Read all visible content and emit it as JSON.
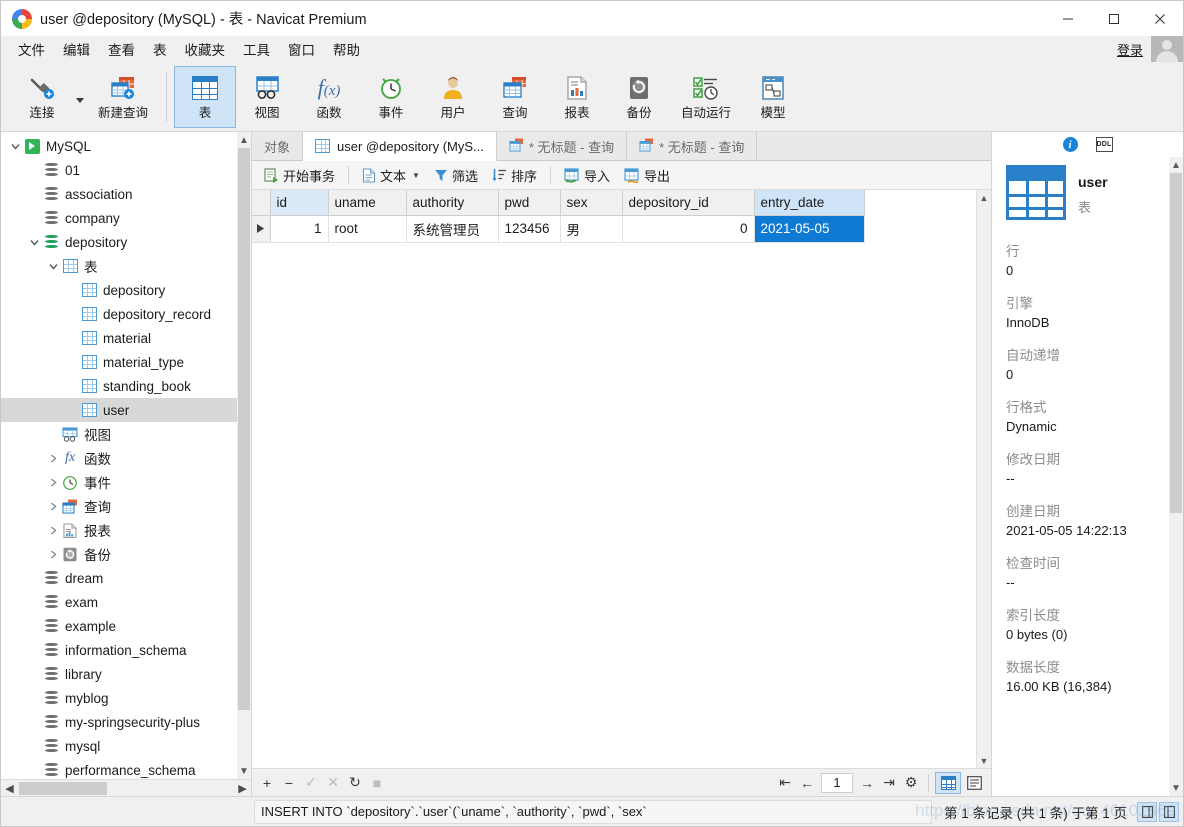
{
  "window": {
    "title": "user @depository (MySQL) - 表 - Navicat Premium",
    "minimize": "—",
    "maximize": "□",
    "close": "✕"
  },
  "menubar": {
    "items": [
      "文件",
      "编辑",
      "查看",
      "表",
      "收藏夹",
      "工具",
      "窗口",
      "帮助"
    ],
    "login_label": "登录"
  },
  "toolbar": {
    "items": [
      {
        "label": "连接",
        "icon": "connection-icon"
      },
      {
        "label": "新建查询",
        "icon": "new-query-icon"
      },
      {
        "label": "表",
        "icon": "table-icon",
        "active": true
      },
      {
        "label": "视图",
        "icon": "view-icon"
      },
      {
        "label": "函数",
        "icon": "function-icon"
      },
      {
        "label": "事件",
        "icon": "event-icon"
      },
      {
        "label": "用户",
        "icon": "user-icon"
      },
      {
        "label": "查询",
        "icon": "query-icon"
      },
      {
        "label": "报表",
        "icon": "report-icon"
      },
      {
        "label": "备份",
        "icon": "backup-icon"
      },
      {
        "label": "自动运行",
        "icon": "automation-icon"
      },
      {
        "label": "模型",
        "icon": "model-icon"
      }
    ]
  },
  "sidebar": {
    "nodes": [
      {
        "label": "MySQL",
        "depth": 0,
        "icon": "mysql-connection-icon",
        "chevron": "down"
      },
      {
        "label": "01",
        "depth": 1,
        "icon": "database-icon",
        "chevron": ""
      },
      {
        "label": "association",
        "depth": 1,
        "icon": "database-icon",
        "chevron": ""
      },
      {
        "label": "company",
        "depth": 1,
        "icon": "database-icon",
        "chevron": ""
      },
      {
        "label": "depository",
        "depth": 1,
        "icon": "database-open-icon",
        "chevron": "down"
      },
      {
        "label": "表",
        "depth": 2,
        "icon": "table-folder-icon",
        "chevron": "down"
      },
      {
        "label": "depository",
        "depth": 3,
        "icon": "table-icon",
        "chevron": ""
      },
      {
        "label": "depository_record",
        "depth": 3,
        "icon": "table-icon",
        "chevron": ""
      },
      {
        "label": "material",
        "depth": 3,
        "icon": "table-icon",
        "chevron": ""
      },
      {
        "label": "material_type",
        "depth": 3,
        "icon": "table-icon",
        "chevron": ""
      },
      {
        "label": "standing_book",
        "depth": 3,
        "icon": "table-icon",
        "chevron": ""
      },
      {
        "label": "user",
        "depth": 3,
        "icon": "table-icon",
        "chevron": "",
        "selected": true
      },
      {
        "label": "视图",
        "depth": 2,
        "icon": "view-folder-icon",
        "chevron": ""
      },
      {
        "label": "函数",
        "depth": 2,
        "icon": "function-folder-icon",
        "chevron": "right"
      },
      {
        "label": "事件",
        "depth": 2,
        "icon": "event-folder-icon",
        "chevron": "right"
      },
      {
        "label": "查询",
        "depth": 2,
        "icon": "query-folder-icon",
        "chevron": "right"
      },
      {
        "label": "报表",
        "depth": 2,
        "icon": "report-folder-icon",
        "chevron": "right"
      },
      {
        "label": "备份",
        "depth": 2,
        "icon": "backup-folder-icon",
        "chevron": "right"
      },
      {
        "label": "dream",
        "depth": 1,
        "icon": "database-icon",
        "chevron": ""
      },
      {
        "label": "exam",
        "depth": 1,
        "icon": "database-icon",
        "chevron": ""
      },
      {
        "label": "example",
        "depth": 1,
        "icon": "database-icon",
        "chevron": ""
      },
      {
        "label": "information_schema",
        "depth": 1,
        "icon": "database-icon",
        "chevron": ""
      },
      {
        "label": "library",
        "depth": 1,
        "icon": "database-icon",
        "chevron": ""
      },
      {
        "label": "myblog",
        "depth": 1,
        "icon": "database-icon",
        "chevron": ""
      },
      {
        "label": "my-springsecurity-plus",
        "depth": 1,
        "icon": "database-icon",
        "chevron": ""
      },
      {
        "label": "mysql",
        "depth": 1,
        "icon": "database-icon",
        "chevron": ""
      },
      {
        "label": "performance_schema",
        "depth": 1,
        "icon": "database-icon",
        "chevron": ""
      }
    ]
  },
  "tabs": [
    {
      "label": "对象",
      "icon": "",
      "active": false
    },
    {
      "label": "user @depository (MyS...",
      "icon": "table-icon",
      "active": true
    },
    {
      "label": "* 无标题 - 查询",
      "icon": "query-icon",
      "active": false
    },
    {
      "label": "* 无标题 - 查询",
      "icon": "query-icon",
      "active": false
    }
  ],
  "gridtools": [
    {
      "label": "开始事务",
      "icon": "transaction-icon"
    },
    {
      "label": "文本",
      "icon": "text-icon",
      "caret": true
    },
    {
      "label": "筛选",
      "icon": "filter-icon"
    },
    {
      "label": "排序",
      "icon": "sort-icon"
    },
    {
      "label": "导入",
      "icon": "import-icon"
    },
    {
      "label": "导出",
      "icon": "export-icon"
    }
  ],
  "grid": {
    "columns": [
      "id",
      "uname",
      "authority",
      "pwd",
      "sex",
      "depository_id",
      "entry_date"
    ],
    "rows": [
      {
        "indicator": "▶",
        "cells": [
          "1",
          "root",
          "系统管理员",
          "123456",
          "男",
          "0",
          "2021-05-05"
        ]
      }
    ],
    "selected_column": "entry_date",
    "selected_cell_value": "2021-05-05"
  },
  "gridfooter": {
    "buttons": [
      "+",
      "−",
      "✓",
      "✕",
      "↻",
      "■"
    ],
    "nav_first": "⇤",
    "nav_prev": "←",
    "page_value": "1",
    "nav_next": "→",
    "nav_last": "⇥",
    "settings": "⚙",
    "view_grid": "grid-view-icon",
    "view_form": "form-view-icon"
  },
  "rightpanel": {
    "info_icon": "info-icon",
    "ddl_label": "DDL",
    "object_name": "user",
    "object_type": "表",
    "fields": [
      {
        "label": "行",
        "value": "0"
      },
      {
        "label": "引擎",
        "value": "InnoDB"
      },
      {
        "label": "自动递增",
        "value": "0"
      },
      {
        "label": "行格式",
        "value": "Dynamic"
      },
      {
        "label": "修改日期",
        "value": "--"
      },
      {
        "label": "创建日期",
        "value": "2021-05-05 14:22:13"
      },
      {
        "label": "检查时间",
        "value": "--"
      },
      {
        "label": "索引长度",
        "value": "0 bytes (0)"
      },
      {
        "label": "数据长度",
        "value": "16.00 KB (16,384)"
      }
    ]
  },
  "statusbar": {
    "sql": "INSERT INTO `depository`.`user`(`uname`, `authority`, `pwd`, `sex`",
    "record_info": "第 1 条记录 (共 1 条) 于第 1 页"
  },
  "watermark": "https://blog.csdn.net/qq_46101869"
}
